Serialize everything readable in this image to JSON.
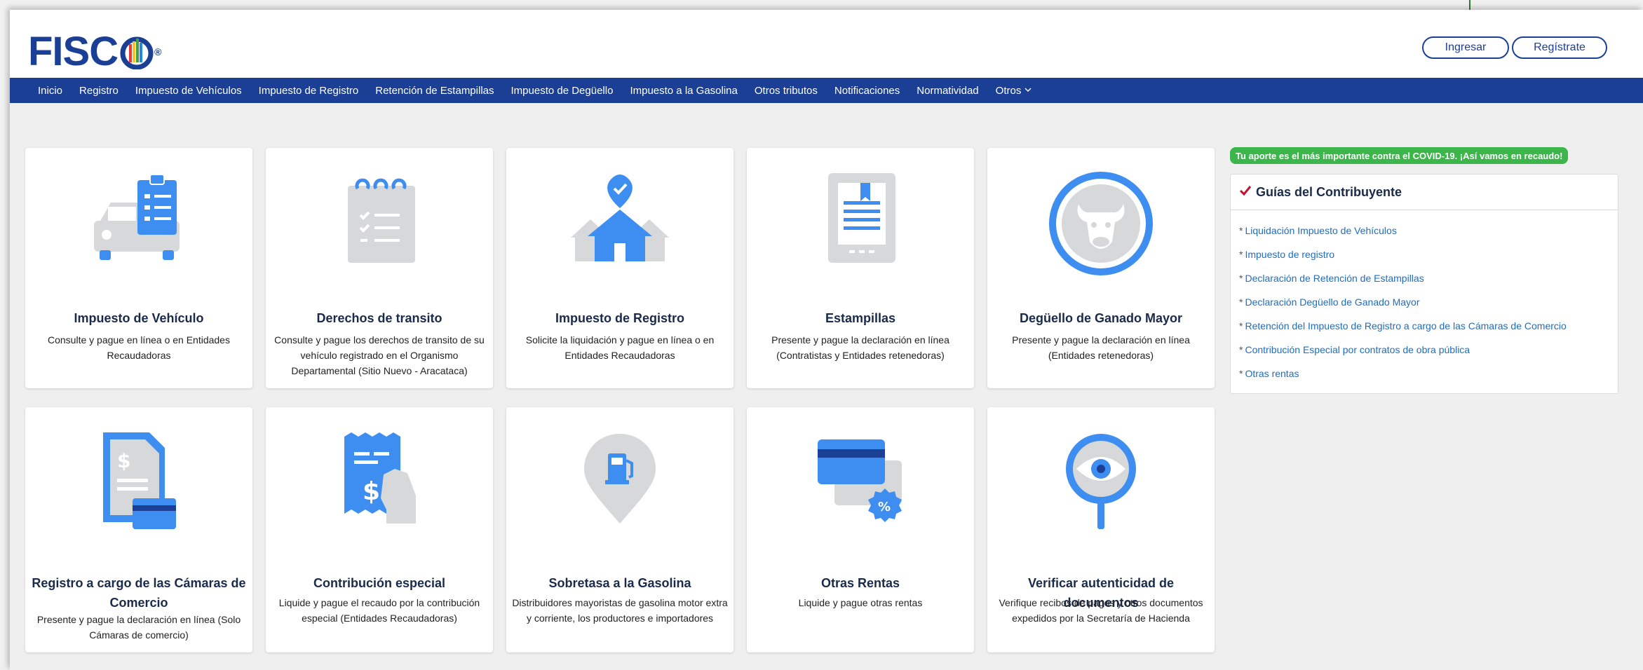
{
  "header": {
    "logo_text": "FISC",
    "logo_reg": "®",
    "login_label": "Ingresar",
    "signup_label": "Regístrate"
  },
  "nav": {
    "items": [
      "Inicio",
      "Registro",
      "Impuesto de Vehículos",
      "Impuesto de Registro",
      "Retención de Estampillas",
      "Impuesto de Degüello",
      "Impuesto a la Gasolina",
      "Otros tributos",
      "Notificaciones",
      "Normatividad",
      "Otros"
    ]
  },
  "cards": [
    {
      "title": "Impuesto de Vehículo",
      "desc": "Consulte y pague en línea o en Entidades Recaudadoras",
      "icon": "car-clipboard-icon"
    },
    {
      "title": "Derechos de transito",
      "desc": "Consulte y pague los derechos de transito de su vehículo registrado en el Organismo Departamental (Sitio Nuevo - Aracataca)",
      "icon": "checklist-notepad-icon"
    },
    {
      "title": "Impuesto de Registro",
      "desc": "Solicite la liquidación y pague en línea o en Entidades Recaudadoras",
      "icon": "house-location-icon"
    },
    {
      "title": "Estampillas",
      "desc": "Presente y pague la declaración en línea (Contratistas y Entidades retenedoras)",
      "icon": "document-bookmark-icon"
    },
    {
      "title": "Degüello de Ganado Mayor",
      "desc": "Presente y pague la declaración en línea (Entidades retenedoras)",
      "icon": "bull-head-icon"
    },
    {
      "title": "Registro a cargo de las Cámaras de Comercio",
      "desc": "Presente y pague la declaración en línea (Solo Cámaras de comercio)",
      "icon": "invoice-card-icon"
    },
    {
      "title": "Contribución especial",
      "desc": "Liquide y pague el recaudo por la contribución especial (Entidades Recaudadoras)",
      "icon": "receipt-hand-icon"
    },
    {
      "title": "Sobretasa a la Gasolina",
      "desc": "Distribuidores mayoristas de gasolina motor extra y corriente, los productores e importadores",
      "icon": "fuel-pin-icon"
    },
    {
      "title": "Otras Rentas",
      "desc": "Liquide y pague otras rentas",
      "icon": "card-percent-icon"
    },
    {
      "title": "Verificar autenticidad de documentos",
      "desc": "Verifique recibos de pagos y otros documentos expedidos por la Secretaría de Hacienda",
      "icon": "eye-search-icon"
    }
  ],
  "covid_banner": "Tu aporte es el más importante contra el COVID-19. ¡Así vamos en recaudo!",
  "guides": {
    "title": "Guías del Contribuyente",
    "items": [
      "Liquidación Impuesto de Vehículos",
      "Impuesto de registro",
      "Declaración de Retención de Estampillas",
      "Declaración Degüello de Ganado Mayor",
      "Retención del Impuesto de Registro a cargo de las Cámaras de Comercio",
      "Contribución Especial por contratos de obra pública",
      "Otras rentas"
    ]
  },
  "colors": {
    "brand_blue": "#1b3f94",
    "icon_blue": "#3d8ef0",
    "icon_gray": "#d7d8da",
    "banner_green": "#3cb54a",
    "link_blue": "#1a6ec6"
  }
}
